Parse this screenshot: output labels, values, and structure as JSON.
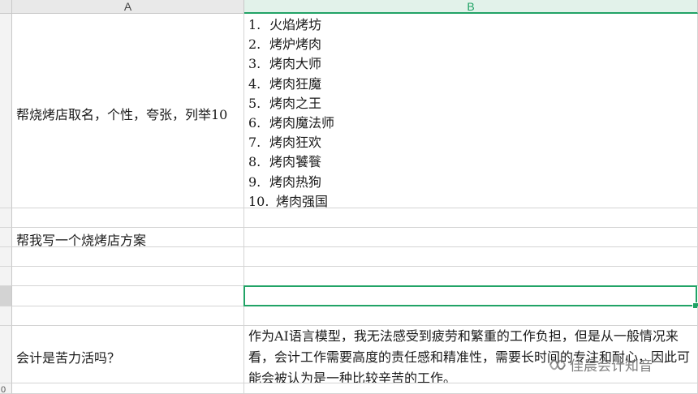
{
  "columns": {
    "a": "A",
    "b": "B"
  },
  "rows": {
    "r1": {
      "a": "帮烧烤店取名，个性，夸张，列举10",
      "b_items": [
        {
          "n": "1.",
          "t": "火焰烤坊"
        },
        {
          "n": "2.",
          "t": "烤炉烤肉"
        },
        {
          "n": "3.",
          "t": "烤肉大师"
        },
        {
          "n": "4.",
          "t": "烤肉狂魔"
        },
        {
          "n": "5.",
          "t": "烤肉之王"
        },
        {
          "n": "6.",
          "t": "烤肉魔法师"
        },
        {
          "n": "7.",
          "t": "烤肉狂欢"
        },
        {
          "n": "8.",
          "t": "烤肉饕餮"
        },
        {
          "n": "9.",
          "t": "烤肉热狗"
        },
        {
          "n": "10.",
          "t": "烤肉强国"
        }
      ]
    },
    "r2": {
      "a": "帮我写一个烧烤店方案",
      "b": ""
    },
    "r3": {
      "a": "会计是苦力活吗？",
      "b": "作为AI语言模型，我无法感受到疲劳和繁重的工作负担，但是从一般情况来看，会计工作需要高度的责任感和精准性，需要长时间的专注和耐心，因此可能会被认为是一种比较辛苦的工作。"
    }
  },
  "row_headers": {
    "last": "0"
  },
  "watermark": {
    "text": "佳晨会计知音",
    "icon": "wechat-channel-icon"
  },
  "colors": {
    "accent": "#21a366"
  }
}
